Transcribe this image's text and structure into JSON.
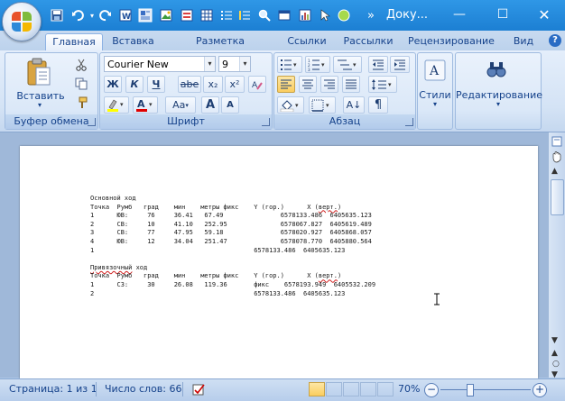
{
  "window": {
    "title": "Доку...",
    "minimize_glyph": "—",
    "maximize_glyph": "☐",
    "close_glyph": "✕"
  },
  "qat": {
    "more_glyph": "»",
    "icons": [
      "save-icon",
      "undo-icon",
      "redo-icon",
      "word-doc-icon",
      "image-icon",
      "insert-picture-icon",
      "table-icon",
      "list-icon",
      "bullets-icon",
      "find-icon",
      "window-icon",
      "chart-icon",
      "cursor-icon",
      "spellcheck-icon"
    ]
  },
  "tabs": [
    {
      "label": "Главная",
      "active": true
    },
    {
      "label": "Вставка"
    },
    {
      "label": "Разметка страницы"
    },
    {
      "label": "Ссылки"
    },
    {
      "label": "Рассылки"
    },
    {
      "label": "Рецензирование"
    },
    {
      "label": "Вид"
    }
  ],
  "help_glyph": "?",
  "ribbon": {
    "clipboard": {
      "label": "Буфер обмена",
      "paste": "Вставить",
      "paste_arrow": "▾"
    },
    "font": {
      "label": "Шрифт",
      "font_name": "Courier New",
      "font_size": "9",
      "bold": "Ж",
      "italic": "К",
      "underline": "Ч",
      "strike": "abe",
      "subscript": "x₂",
      "superscript": "x²",
      "change_case": "Aa",
      "grow": "A",
      "shrink": "A",
      "highlight_color": "#ffff00",
      "text_color": "#e00000"
    },
    "paragraph": {
      "label": "Абзац",
      "sort_glyph": "А↓",
      "pilcrow": "¶"
    },
    "styles": {
      "label": "Стили"
    },
    "editing": {
      "label": "Редактирование"
    }
  },
  "document": {
    "lines": [
      {
        "text": "Основной ход"
      },
      {
        "text": "Точка  Румб   град    мин    метры фикс    Y (гор.)      X (верт.)",
        "wavy": "верт."
      },
      {
        "text": "1      ЮВ:     76     36.41   67.49               6578133.486  6405635.123"
      },
      {
        "text": "2      СВ:     10     41.10   252.95              6578067.827  6405619.489"
      },
      {
        "text": "3      СВ:     77     47.95   59.18               6578020.927  6405868.057"
      },
      {
        "text": "4      ЮВ:     12     34.04   251.47              6578078.770  6405880.564"
      },
      {
        "text": "1                                          6578133.486  6405635.123"
      },
      {
        "text": ""
      },
      {
        "text": "Привязочный ход",
        "wavy": "Привязочный"
      },
      {
        "text": "Точка  Румб   град    мин    метры фикс    Y (гор.)      X (верт.)",
        "wavy": "верт."
      },
      {
        "text": "1      СЗ:     30     26.08   119.36       фикс    6578193.949  6405532.209"
      },
      {
        "text": "2                                          6578133.486  6405635.123"
      }
    ]
  },
  "status": {
    "page": "Страница: 1 из 1",
    "words": "Число слов: 66",
    "zoom": "70%",
    "minus": "−",
    "plus": "+"
  }
}
